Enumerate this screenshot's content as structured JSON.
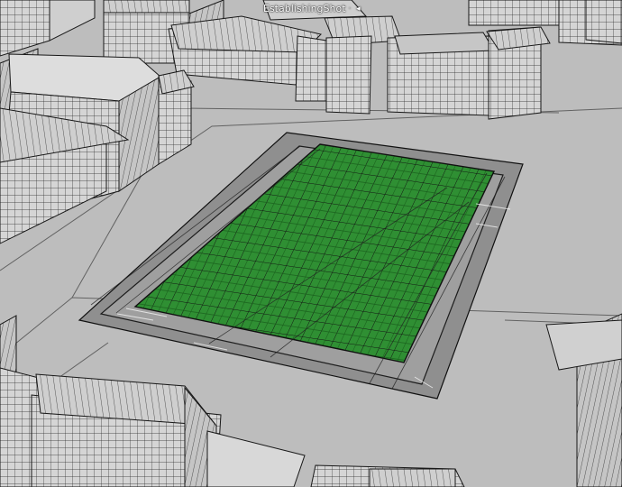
{
  "viewport": {
    "camera_name": "EstablishingShot",
    "camera_separator": "·",
    "camera_menu_icon": "camera-menu-icon"
  },
  "scene": {
    "selected_object": "green grid plane",
    "colors": {
      "background": "#bfbfbf",
      "ground": "#c9c9c9",
      "building_light": "#d7d7d7",
      "building_mid": "#bdbdbd",
      "building_dark": "#a8a8a8",
      "wire": "#111111",
      "selection_green": "#2f8f33",
      "border_gray": "#8f8f8f"
    }
  }
}
